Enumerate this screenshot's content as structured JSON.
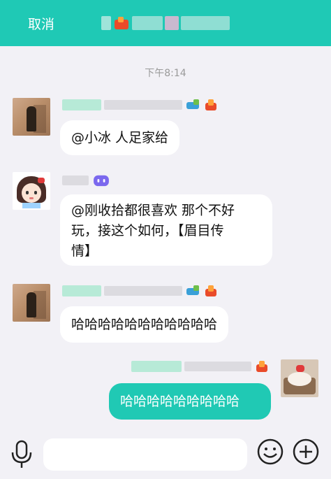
{
  "header": {
    "cancel_label": "取消",
    "bg_color": "#1fc9b5"
  },
  "chat": {
    "timestamp": "下午8:14",
    "messages": [
      {
        "sender": "other",
        "avatar": "brown-photo",
        "text": "@小冰  人足家给",
        "icons": [
          "dragon-icon",
          "fire-icon"
        ]
      },
      {
        "sender": "bot",
        "avatar": "girl-avatar",
        "text_lines": [
          "@刚收拾都很喜欢 那个不好",
          "玩，接这个如何，【眉目传",
          "情】"
        ],
        "icons": [
          "robot-badge-icon"
        ]
      },
      {
        "sender": "other",
        "avatar": "brown-photo",
        "text": "哈哈哈哈哈哈哈哈哈哈哈",
        "icons": [
          "dragon-icon",
          "fire-icon"
        ]
      },
      {
        "sender": "me",
        "avatar": "cake-avatar",
        "text": "哈哈哈哈哈哈哈哈哈",
        "icons": [
          "fire-icon"
        ]
      }
    ]
  },
  "input_bar": {
    "placeholder": ""
  },
  "colors": {
    "accent": "#1fc9b5",
    "background": "#f2f1f6"
  }
}
